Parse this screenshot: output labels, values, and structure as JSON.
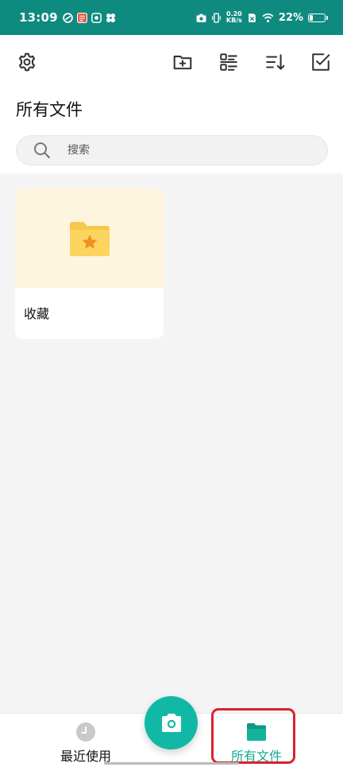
{
  "status_bar": {
    "time": "13:09",
    "net_speed_value": "0.20",
    "net_speed_unit": "KB/s",
    "battery_percent": "22%",
    "battery_level": 0.22
  },
  "toolbar": {
    "icons": [
      "settings-icon",
      "new-folder-icon",
      "view-list-icon",
      "sort-icon",
      "select-icon"
    ]
  },
  "page": {
    "title": "所有文件"
  },
  "search": {
    "placeholder": "搜索"
  },
  "folders": [
    {
      "name": "收藏",
      "icon": "star-folder-icon",
      "thumb_color": "#fdf5dd",
      "icon_color": "#f7c84a"
    }
  ],
  "bottom_nav": {
    "items": [
      {
        "label": "最近使用",
        "icon": "clock-icon",
        "active": false
      },
      {
        "label": "所有文件",
        "icon": "folder-open-icon",
        "active": true
      }
    ],
    "fab_icon": "camera-icon"
  },
  "colors": {
    "status_bar": "#0f8a7f",
    "accent": "#12a892",
    "fab": "#12b8a6",
    "highlight": "#d8242f"
  }
}
